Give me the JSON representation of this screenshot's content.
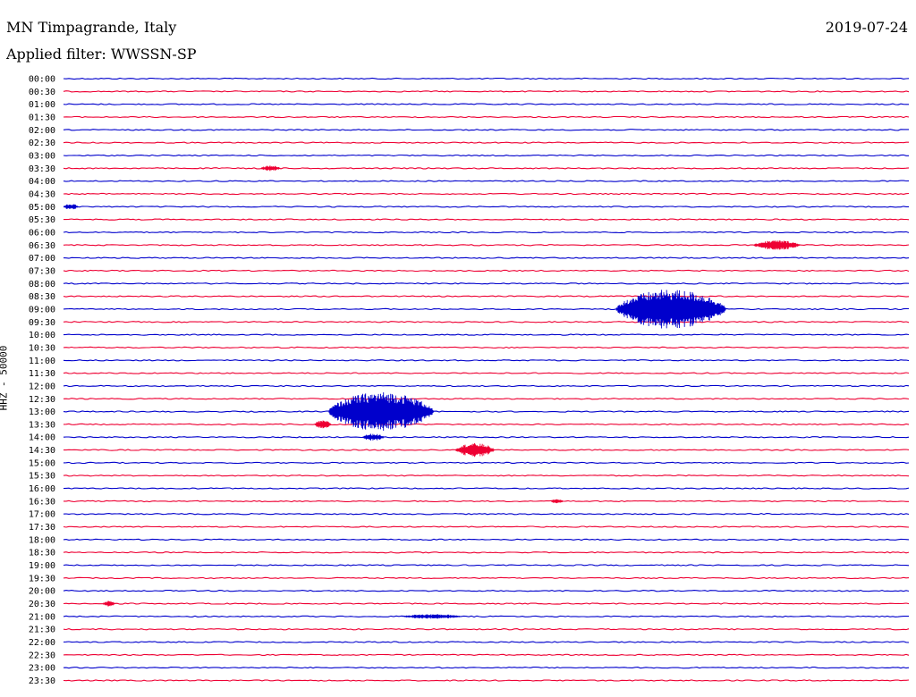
{
  "header": {
    "station": "MN Timpagrande, Italy",
    "filter": "Applied filter: WWSSN-SP",
    "date": "2019-07-24"
  },
  "chart_data": {
    "type": "line",
    "title": "MN Timpagrande, Italy",
    "subtitle": "Applied filter: WWSSN-SP",
    "date": "2019-07-24",
    "ylabel": "HHZ - 50000",
    "xlabel": "",
    "row_labels": [
      "00:00",
      "00:30",
      "01:00",
      "01:30",
      "02:00",
      "02:30",
      "03:00",
      "03:30",
      "04:00",
      "04:30",
      "05:00",
      "05:30",
      "06:00",
      "06:30",
      "07:00",
      "07:30",
      "08:00",
      "08:30",
      "09:00",
      "09:30",
      "10:00",
      "10:30",
      "11:00",
      "11:30",
      "12:00",
      "12:30",
      "13:00",
      "13:30",
      "14:00",
      "14:30",
      "15:00",
      "15:30",
      "16:00",
      "16:30",
      "17:00",
      "17:30",
      "18:00",
      "18:30",
      "19:00",
      "19:30",
      "20:00",
      "20:30",
      "21:00",
      "21:30",
      "22:00",
      "22:30",
      "23:00",
      "23:30"
    ],
    "series_colors": [
      "#0000cc",
      "#ee0033"
    ],
    "row_duration_minutes": 30,
    "events": [
      {
        "row": "03:30",
        "start_min": 7.0,
        "end_min": 7.8,
        "amplitude": 0.15
      },
      {
        "row": "05:00",
        "start_min": 0.0,
        "end_min": 0.6,
        "amplitude": 0.15
      },
      {
        "row": "06:30",
        "start_min": 24.5,
        "end_min": 26.4,
        "amplitude": 0.25
      },
      {
        "row": "09:00",
        "start_min": 19.6,
        "end_min": 24.1,
        "amplitude": 1.0
      },
      {
        "row": "13:00",
        "start_min": 9.4,
        "end_min": 13.7,
        "amplitude": 1.0
      },
      {
        "row": "13:30",
        "start_min": 8.9,
        "end_min": 9.6,
        "amplitude": 0.2
      },
      {
        "row": "14:00",
        "start_min": 10.6,
        "end_min": 11.5,
        "amplitude": 0.18
      },
      {
        "row": "14:30",
        "start_min": 13.9,
        "end_min": 15.5,
        "amplitude": 0.35
      },
      {
        "row": "16:30",
        "start_min": 17.3,
        "end_min": 17.8,
        "amplitude": 0.12
      },
      {
        "row": "20:30",
        "start_min": 1.4,
        "end_min": 1.9,
        "amplitude": 0.15
      },
      {
        "row": "21:00",
        "start_min": 12.0,
        "end_min": 14.5,
        "amplitude": 0.12
      }
    ],
    "grid": false,
    "legend": "none"
  }
}
